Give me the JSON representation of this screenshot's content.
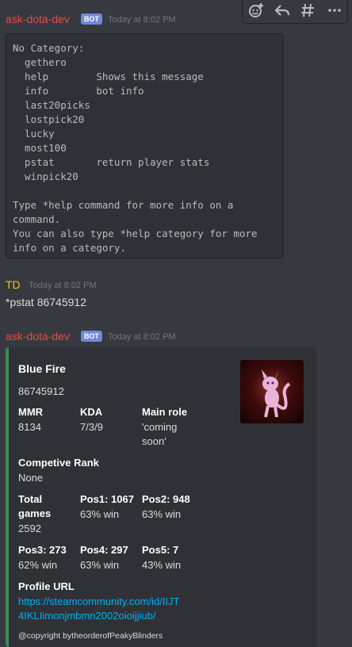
{
  "toolbar": {
    "icons": [
      "add-reaction-icon",
      "reply-icon",
      "thread-icon",
      "more-icon"
    ]
  },
  "message1": {
    "username": "ask-dota-dev",
    "username_color": "#f04747",
    "badge": "BOT",
    "timestamp": "Today at 8:02 PM",
    "code": "No Category:\n  gethero\n  help        Shows this message\n  info        bot info\n  last20picks\n  lostpick20\n  lucky\n  most100\n  pstat       return player stats\n  winpick20\n\nType *help command for more info on a\ncommand.\nYou can also type *help category for more\ninfo on a category."
  },
  "message2": {
    "username": "TD",
    "username_color": "#f1c40f",
    "timestamp": "Today at 8:02 PM",
    "text": "*pstat 86745912"
  },
  "message3": {
    "username": "ask-dota-dev",
    "username_color": "#f04747",
    "badge": "BOT",
    "timestamp": "Today at 8:02 PM",
    "embed": {
      "accent": "#3a8a5a",
      "title": "Blue Fire",
      "description": "86745912",
      "fields": {
        "mmr": {
          "name": "MMR",
          "value": "8134"
        },
        "kda": {
          "name": "KDA",
          "value": "7/3/9"
        },
        "main_role": {
          "name": "Main role",
          "value1": "'coming",
          "value2": "soon'"
        },
        "rank": {
          "name": "Competive Rank",
          "value": "None"
        },
        "total_games": {
          "name1": "Total",
          "name2": "games",
          "value": "2592"
        },
        "pos1": {
          "name": "Pos1: 1067",
          "value": "63% win"
        },
        "pos2": {
          "name": "Pos2: 948",
          "value": "63% win"
        },
        "pos3": {
          "name": "Pos3: 273",
          "value": "62% win"
        },
        "pos4": {
          "name": "Pos4: 297",
          "value": "63% win"
        },
        "pos5": {
          "name": "Pos5: 7",
          "value": "43% win"
        },
        "profile": {
          "name": "Profile URL",
          "line1": "https://steamcommunity.com/id/IIJT",
          "line2": "4IKLIimonjmbmn2002oioijjiub/"
        }
      },
      "footer": "@copyright bytheorderofPeakyBlinders"
    }
  }
}
